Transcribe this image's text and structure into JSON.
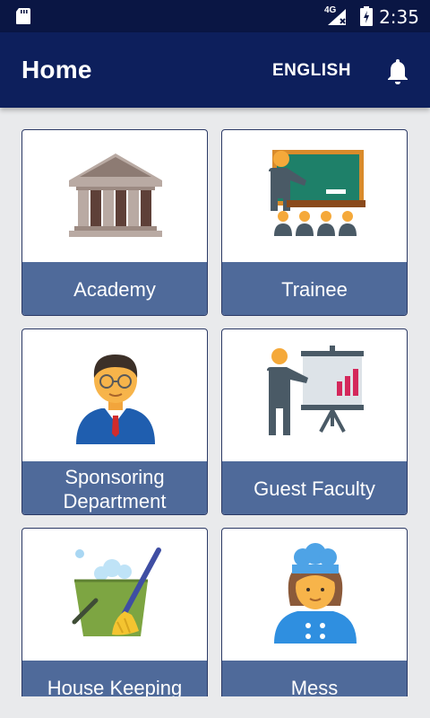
{
  "status_bar": {
    "time": "2:35",
    "network_label": "4G",
    "icons": [
      "sd-card-icon",
      "signal-icon",
      "battery-charging-icon"
    ]
  },
  "app_bar": {
    "title": "Home",
    "language_button": "ENGLISH",
    "notification_icon": "bell-icon"
  },
  "tiles": [
    {
      "label": "Academy",
      "icon": "academy-building-icon"
    },
    {
      "label": "Trainee",
      "icon": "classroom-teacher-icon"
    },
    {
      "label": "Sponsoring Department",
      "icon": "businessman-icon"
    },
    {
      "label": "Guest Faculty",
      "icon": "presentation-icon"
    },
    {
      "label": "House Keeping",
      "icon": "cleaning-bucket-icon"
    },
    {
      "label": "Mess",
      "icon": "chef-icon"
    }
  ],
  "colors": {
    "status_bar": "#0a1644",
    "app_bar": "#0d1f5c",
    "tile_label_bg": "#4f6a9a",
    "background": "#e9eaec"
  }
}
